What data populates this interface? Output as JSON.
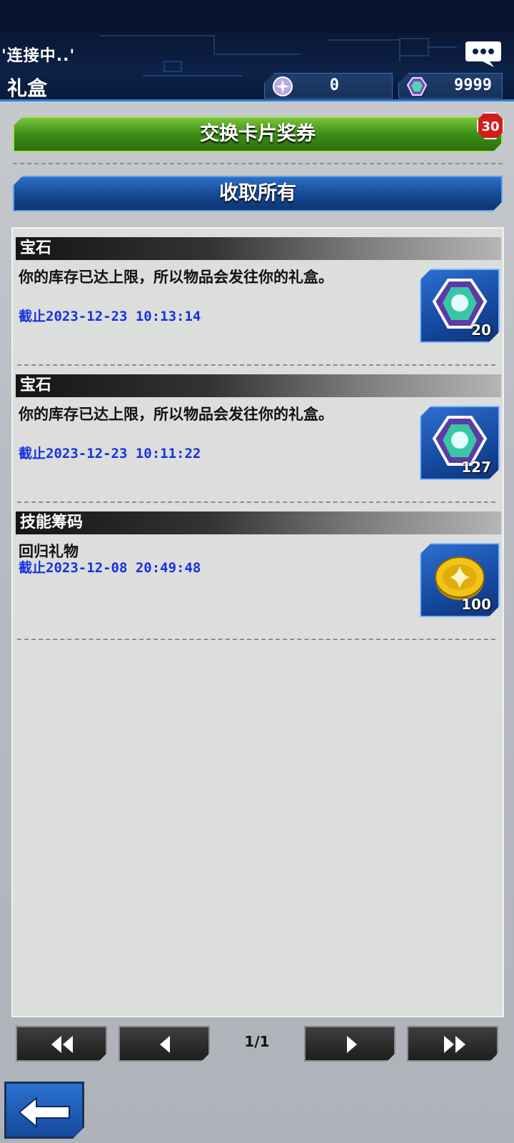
{
  "header": {
    "status_text": "'连接中..'",
    "title": "礼盒",
    "orb_count": "0",
    "gem_count": "9999"
  },
  "actions": {
    "exchange_label": "交换卡片奖券",
    "exchange_badge": "30",
    "collect_all_label": "收取所有"
  },
  "gifts": [
    {
      "category": "宝石",
      "description": "你的库存已达上限，所以物品会发往你的礼盒。",
      "deadline_prefix": "截止",
      "deadline": "2023-12-23 10:13:14",
      "icon": "gem-icon",
      "quantity": "20"
    },
    {
      "category": "宝石",
      "description": "你的库存已达上限，所以物品会发往你的礼盒。",
      "deadline_prefix": "截止",
      "deadline": "2023-12-23 10:11:22",
      "icon": "gem-icon",
      "quantity": "127"
    },
    {
      "category": "技能筹码",
      "description": "回归礼物",
      "deadline_prefix": "截止",
      "deadline": "2023-12-08 20:49:48",
      "icon": "skill-chip-coin-icon",
      "quantity": "100"
    }
  ],
  "pagination": {
    "page": "1/1"
  },
  "colors": {
    "header_bg": "#0c2247",
    "exchange_green": "#3c8f17",
    "collect_blue": "#164c97",
    "deadline_blue": "#1531e0",
    "badge_red": "#d21c1c"
  }
}
